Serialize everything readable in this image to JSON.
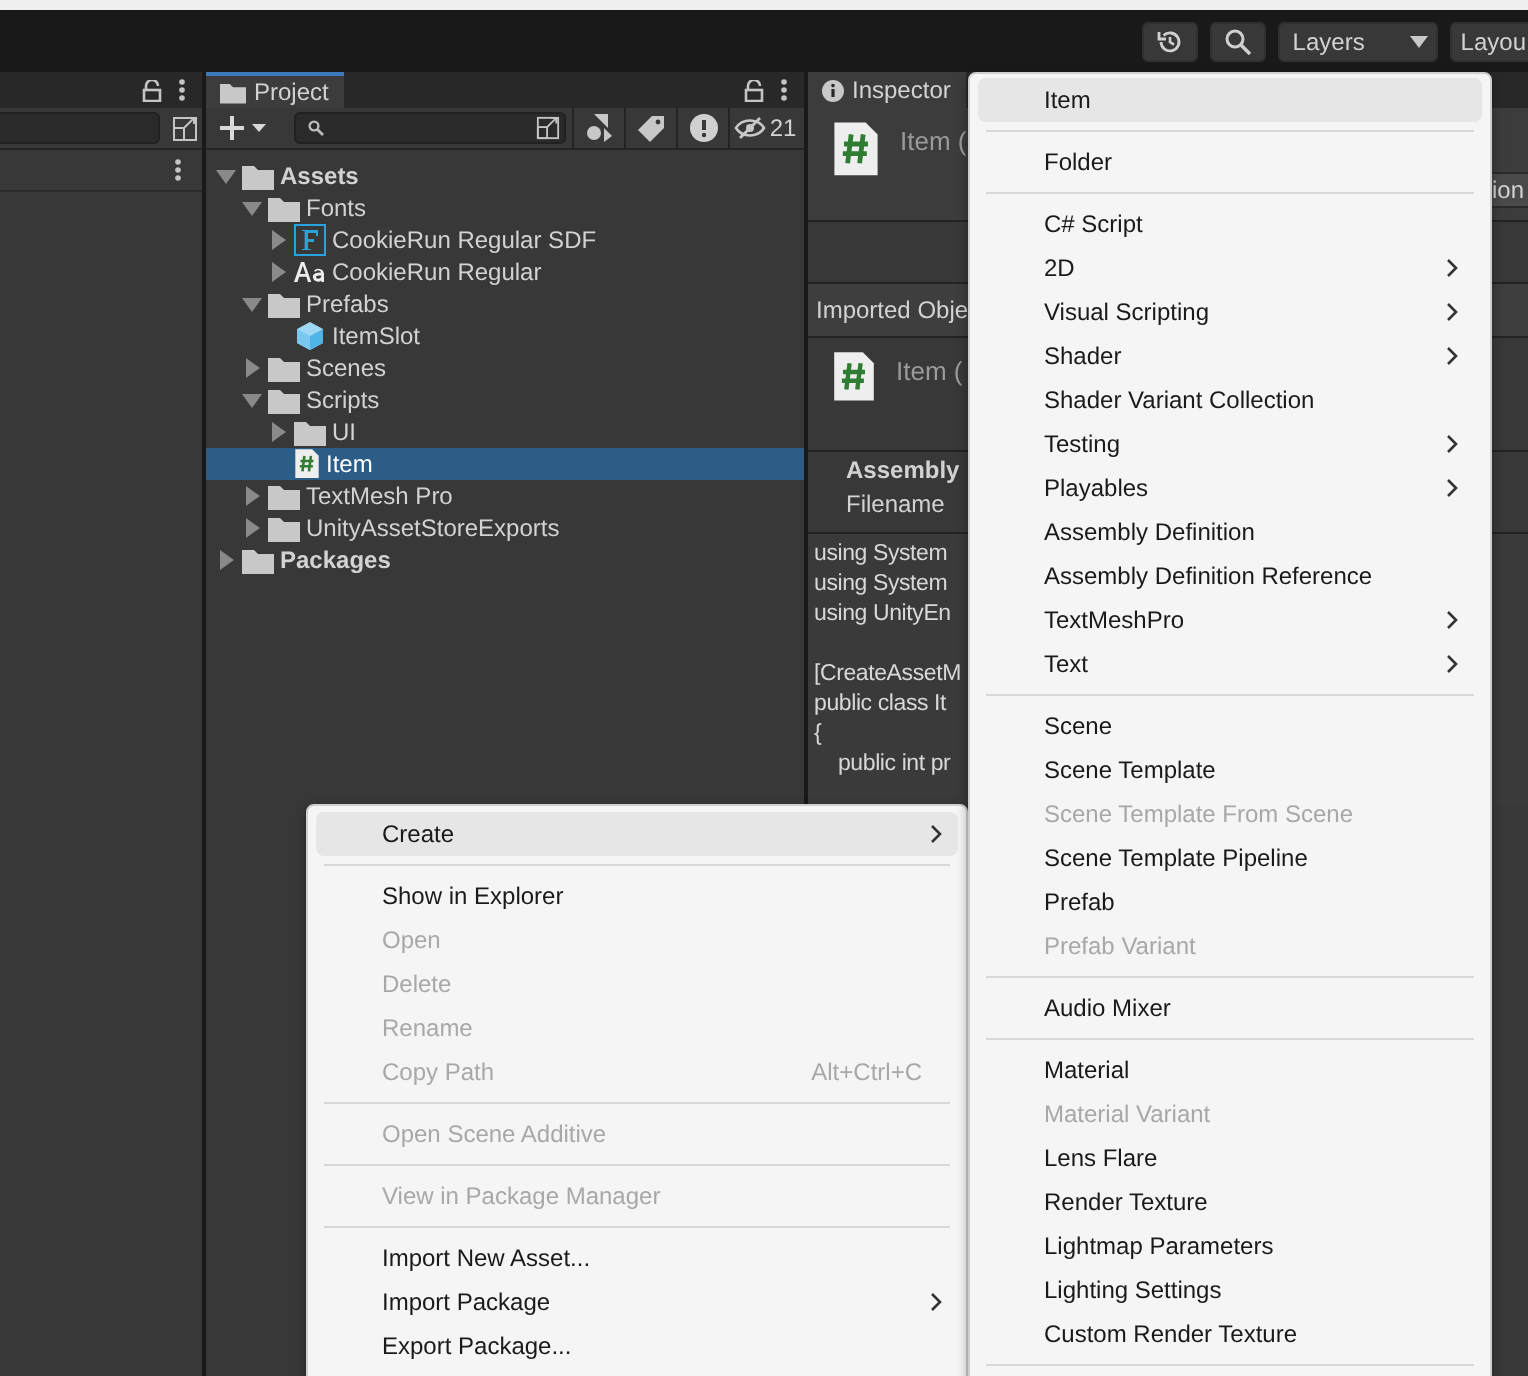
{
  "toolbar": {
    "layers": "Layers",
    "layout": "Layou"
  },
  "project": {
    "tab": "Project",
    "hidden_count": "21",
    "tree": [
      {
        "label": "Assets",
        "kind": "folder",
        "expanded": true,
        "selected": false,
        "children": [
          {
            "label": "Fonts",
            "kind": "folder",
            "expanded": true,
            "selected": false,
            "children": [
              {
                "label": "CookieRun Regular SDF",
                "kind": "font-sdf",
                "expanded": false,
                "selected": false
              },
              {
                "label": "CookieRun Regular",
                "kind": "font",
                "expanded": false,
                "selected": false
              }
            ]
          },
          {
            "label": "Prefabs",
            "kind": "folder",
            "expanded": true,
            "selected": false,
            "children": [
              {
                "label": "ItemSlot",
                "kind": "prefab",
                "selected": false
              }
            ]
          },
          {
            "label": "Scenes",
            "kind": "folder",
            "expanded": false,
            "selected": false
          },
          {
            "label": "Scripts",
            "kind": "folder",
            "expanded": true,
            "selected": false,
            "children": [
              {
                "label": "UI",
                "kind": "folder",
                "expanded": false,
                "selected": false
              },
              {
                "label": "Item",
                "kind": "script",
                "selected": true
              }
            ]
          },
          {
            "label": "TextMesh Pro",
            "kind": "folder",
            "expanded": false,
            "selected": false
          },
          {
            "label": "UnityAssetStoreExports",
            "kind": "folder",
            "expanded": false,
            "selected": false
          }
        ]
      },
      {
        "label": "Packages",
        "kind": "folder",
        "expanded": false,
        "selected": false
      }
    ]
  },
  "inspector": {
    "tab": "Inspector",
    "title": "Item (",
    "button": "ion",
    "section": "Imported Obje",
    "asset_title": "Item (",
    "assembly": "Assembly",
    "filename": "Filename",
    "code": [
      {
        "text": "using System"
      },
      {
        "text": "using System"
      },
      {
        "text": "using UnityEn"
      },
      {
        "text": "[CreateAssetM",
        "blank_before": true
      },
      {
        "text": "public class It"
      },
      {
        "text": "{"
      },
      {
        "text": "    public int pr"
      }
    ]
  },
  "context_menu": [
    {
      "kind": "item",
      "label": "Create",
      "selected": true,
      "disabled": false,
      "submenu": true
    },
    {
      "kind": "separator"
    },
    {
      "kind": "item",
      "label": "Show in Explorer",
      "selected": false,
      "disabled": false,
      "submenu": false
    },
    {
      "kind": "item",
      "label": "Open",
      "selected": false,
      "disabled": true,
      "submenu": false
    },
    {
      "kind": "item",
      "label": "Delete",
      "selected": false,
      "disabled": true,
      "submenu": false
    },
    {
      "kind": "item",
      "label": "Rename",
      "selected": false,
      "disabled": true,
      "submenu": false
    },
    {
      "kind": "item",
      "label": "Copy Path",
      "selected": false,
      "disabled": true,
      "submenu": false,
      "shortcut": "Alt+Ctrl+C"
    },
    {
      "kind": "separator"
    },
    {
      "kind": "item",
      "label": "Open Scene Additive",
      "selected": false,
      "disabled": true,
      "submenu": false
    },
    {
      "kind": "separator"
    },
    {
      "kind": "item",
      "label": "View in Package Manager",
      "selected": false,
      "disabled": true,
      "submenu": false
    },
    {
      "kind": "separator"
    },
    {
      "kind": "item",
      "label": "Import New Asset...",
      "selected": false,
      "disabled": false,
      "submenu": false
    },
    {
      "kind": "item",
      "label": "Import Package",
      "selected": false,
      "disabled": false,
      "submenu": true
    },
    {
      "kind": "item",
      "label": "Export Package...",
      "selected": false,
      "disabled": false,
      "submenu": false
    }
  ],
  "create_menu": [
    {
      "kind": "item",
      "label": "Item",
      "selected": true,
      "disabled": false,
      "submenu": false
    },
    {
      "kind": "separator"
    },
    {
      "kind": "item",
      "label": "Folder",
      "selected": false,
      "disabled": false,
      "submenu": false
    },
    {
      "kind": "separator"
    },
    {
      "kind": "item",
      "label": "C# Script",
      "selected": false,
      "disabled": false,
      "submenu": false
    },
    {
      "kind": "item",
      "label": "2D",
      "selected": false,
      "disabled": false,
      "submenu": true
    },
    {
      "kind": "item",
      "label": "Visual Scripting",
      "selected": false,
      "disabled": false,
      "submenu": true
    },
    {
      "kind": "item",
      "label": "Shader",
      "selected": false,
      "disabled": false,
      "submenu": true
    },
    {
      "kind": "item",
      "label": "Shader Variant Collection",
      "selected": false,
      "disabled": false,
      "submenu": false
    },
    {
      "kind": "item",
      "label": "Testing",
      "selected": false,
      "disabled": false,
      "submenu": true
    },
    {
      "kind": "item",
      "label": "Playables",
      "selected": false,
      "disabled": false,
      "submenu": true
    },
    {
      "kind": "item",
      "label": "Assembly Definition",
      "selected": false,
      "disabled": false,
      "submenu": false
    },
    {
      "kind": "item",
      "label": "Assembly Definition Reference",
      "selected": false,
      "disabled": false,
      "submenu": false
    },
    {
      "kind": "item",
      "label": "TextMeshPro",
      "selected": false,
      "disabled": false,
      "submenu": true
    },
    {
      "kind": "item",
      "label": "Text",
      "selected": false,
      "disabled": false,
      "submenu": true
    },
    {
      "kind": "separator"
    },
    {
      "kind": "item",
      "label": "Scene",
      "selected": false,
      "disabled": false,
      "submenu": false
    },
    {
      "kind": "item",
      "label": "Scene Template",
      "selected": false,
      "disabled": false,
      "submenu": false
    },
    {
      "kind": "item",
      "label": "Scene Template From Scene",
      "selected": false,
      "disabled": true,
      "submenu": false
    },
    {
      "kind": "item",
      "label": "Scene Template Pipeline",
      "selected": false,
      "disabled": false,
      "submenu": false
    },
    {
      "kind": "item",
      "label": "Prefab",
      "selected": false,
      "disabled": false,
      "submenu": false
    },
    {
      "kind": "item",
      "label": "Prefab Variant",
      "selected": false,
      "disabled": true,
      "submenu": false
    },
    {
      "kind": "separator"
    },
    {
      "kind": "item",
      "label": "Audio Mixer",
      "selected": false,
      "disabled": false,
      "submenu": false
    },
    {
      "kind": "separator"
    },
    {
      "kind": "item",
      "label": "Material",
      "selected": false,
      "disabled": false,
      "submenu": false
    },
    {
      "kind": "item",
      "label": "Material Variant",
      "selected": false,
      "disabled": true,
      "submenu": false
    },
    {
      "kind": "item",
      "label": "Lens Flare",
      "selected": false,
      "disabled": false,
      "submenu": false
    },
    {
      "kind": "item",
      "label": "Render Texture",
      "selected": false,
      "disabled": false,
      "submenu": false
    },
    {
      "kind": "item",
      "label": "Lightmap Parameters",
      "selected": false,
      "disabled": false,
      "submenu": false
    },
    {
      "kind": "item",
      "label": "Lighting Settings",
      "selected": false,
      "disabled": false,
      "submenu": false
    },
    {
      "kind": "item",
      "label": "Custom Render Texture",
      "selected": false,
      "disabled": false,
      "submenu": false
    },
    {
      "kind": "separator"
    }
  ]
}
